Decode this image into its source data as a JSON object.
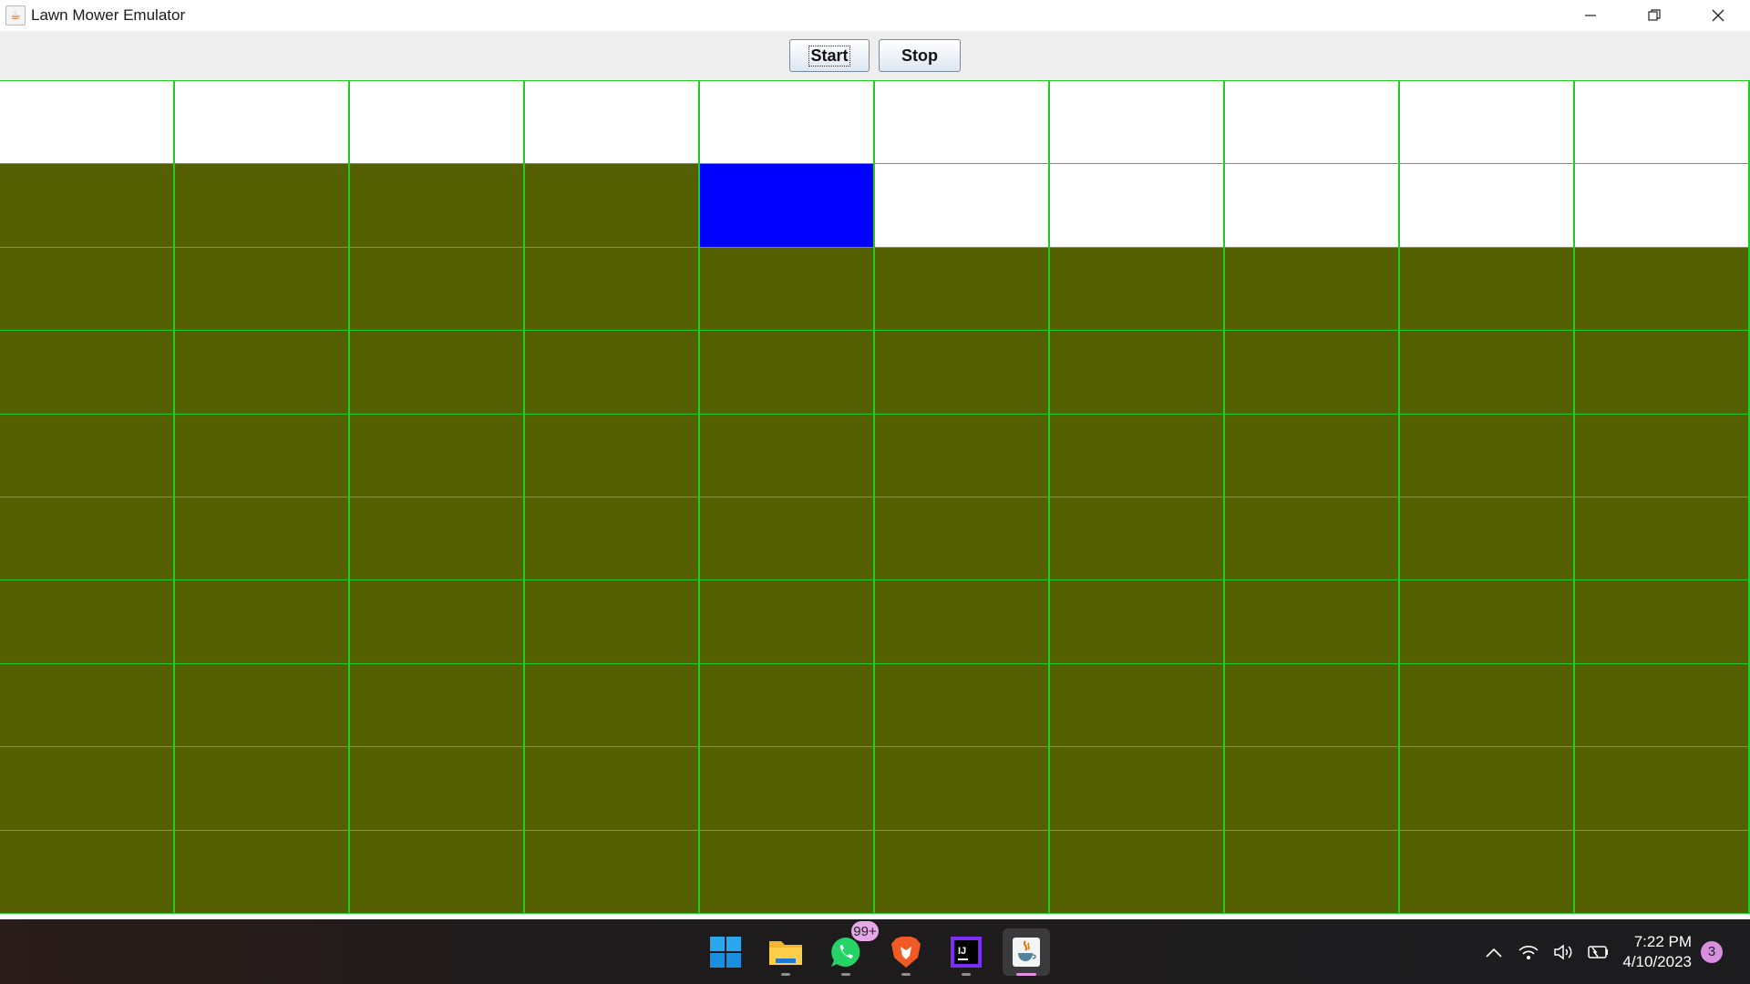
{
  "window": {
    "title": "Lawn Mower Emulator",
    "app_icon": "java-cup-icon",
    "controls": {
      "minimize": "—",
      "restore": "❐",
      "close": "✕"
    }
  },
  "toolbar": {
    "start_label": "Start",
    "stop_label": "Stop"
  },
  "lawn": {
    "rows": 10,
    "cols": 10,
    "colors": {
      "unmowed": "#556003",
      "mowed": "#ffffff",
      "mower": "#0000ff",
      "grid_line": "#22cc22"
    },
    "cells": [
      [
        "mowed",
        "mowed",
        "mowed",
        "mowed",
        "mowed",
        "mowed",
        "mowed",
        "mowed",
        "mowed",
        "mowed"
      ],
      [
        "unmowed",
        "unmowed",
        "unmowed",
        "unmowed",
        "mower",
        "mowed",
        "mowed",
        "mowed",
        "mowed",
        "mowed"
      ],
      [
        "unmowed",
        "unmowed",
        "unmowed",
        "unmowed",
        "unmowed",
        "unmowed",
        "unmowed",
        "unmowed",
        "unmowed",
        "unmowed"
      ],
      [
        "unmowed",
        "unmowed",
        "unmowed",
        "unmowed",
        "unmowed",
        "unmowed",
        "unmowed",
        "unmowed",
        "unmowed",
        "unmowed"
      ],
      [
        "unmowed",
        "unmowed",
        "unmowed",
        "unmowed",
        "unmowed",
        "unmowed",
        "unmowed",
        "unmowed",
        "unmowed",
        "unmowed"
      ],
      [
        "unmowed",
        "unmowed",
        "unmowed",
        "unmowed",
        "unmowed",
        "unmowed",
        "unmowed",
        "unmowed",
        "unmowed",
        "unmowed"
      ],
      [
        "unmowed",
        "unmowed",
        "unmowed",
        "unmowed",
        "unmowed",
        "unmowed",
        "unmowed",
        "unmowed",
        "unmowed",
        "unmowed"
      ],
      [
        "unmowed",
        "unmowed",
        "unmowed",
        "unmowed",
        "unmowed",
        "unmowed",
        "unmowed",
        "unmowed",
        "unmowed",
        "unmowed"
      ],
      [
        "unmowed",
        "unmowed",
        "unmowed",
        "unmowed",
        "unmowed",
        "unmowed",
        "unmowed",
        "unmowed",
        "unmowed",
        "unmowed"
      ],
      [
        "unmowed",
        "unmowed",
        "unmowed",
        "unmowed",
        "unmowed",
        "unmowed",
        "unmowed",
        "unmowed",
        "unmowed",
        "unmowed"
      ]
    ]
  },
  "taskbar": {
    "apps": [
      {
        "name": "start-menu",
        "icon": "windows-logo-icon"
      },
      {
        "name": "file-explorer",
        "icon": "folder-icon"
      },
      {
        "name": "whatsapp",
        "icon": "whatsapp-icon",
        "badge": "99+"
      },
      {
        "name": "brave",
        "icon": "brave-lion-icon"
      },
      {
        "name": "intellij",
        "icon": "intellij-icon"
      },
      {
        "name": "java",
        "icon": "java-cup-icon",
        "active": true
      }
    ],
    "tray": {
      "icons": [
        "chevron-up-icon",
        "wifi-icon",
        "volume-icon",
        "battery-icon"
      ],
      "time": "7:22 PM",
      "date": "4/10/2023",
      "notifications": "3"
    }
  }
}
